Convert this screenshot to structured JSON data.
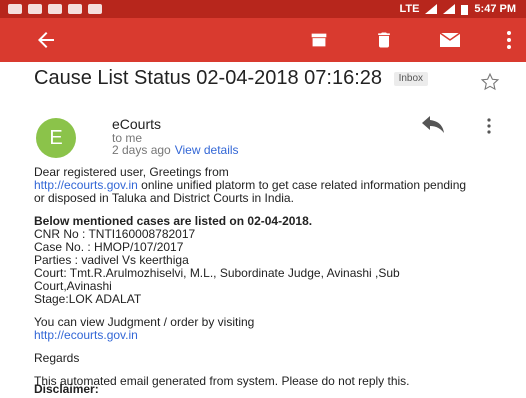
{
  "status_bar": {
    "time": "5:47 PM",
    "network": "LTE"
  },
  "toolbar": {
    "back_icon": "arrow-left-icon",
    "archive_icon": "archive-icon",
    "delete_icon": "trash-icon",
    "mail_icon": "mail-icon",
    "more_icon": "overflow-menu-icon"
  },
  "email": {
    "subject": "Cause List Status 02-04-2018 07:16:28",
    "label": "Inbox",
    "sender_initial": "E",
    "sender_name": "eCourts",
    "recipient": "to me",
    "time": "2 days ago",
    "details_link": "View details",
    "greeting_line1": "Dear registered user, Greetings from",
    "site_link": "http://ecourts.gov.in",
    "greeting_line2": " online unified platorm to get case related information pending or disposed in Taluka and District Courts in India.",
    "cases_heading": "Below mentioned cases are listed on 02-04-2018.",
    "cnr": "CNR No : TNTI160008782017",
    "case_no": "Case No. : HMOP/107/2017",
    "parties": "Parties : vadivel Vs keerthiga",
    "court": "Court: Tmt.R.Arulmozhiselvi, M.L., Subordinate Judge, Avinashi ,Sub Court,Avinashi",
    "stage": "Stage:LOK ADALAT",
    "judgment_text": "You can view Judgment / order by visiting",
    "judgment_link": "http://ecourts.gov.in",
    "regards": "Regards",
    "auto_note": "This automated email generated from system. Please do not reply this.",
    "disclaimer": "Disclaimer:"
  },
  "colors": {
    "status_bar": "#b7261c",
    "toolbar": "#d93a2f",
    "avatar": "#8bc34a",
    "link": "#3367d6"
  }
}
